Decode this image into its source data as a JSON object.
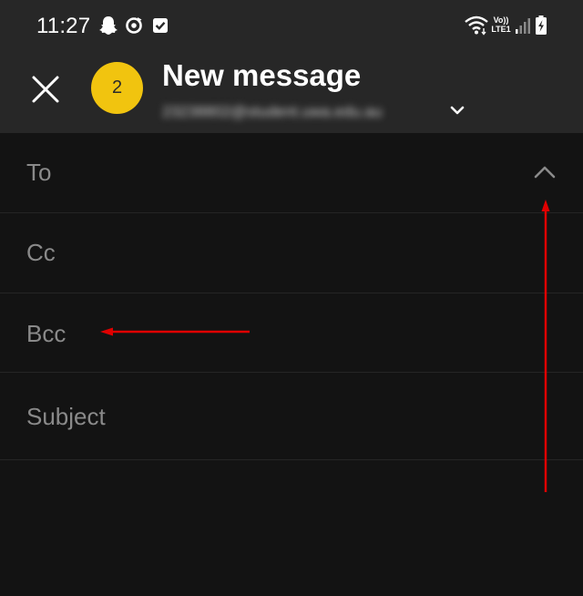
{
  "status_bar": {
    "time": "11:27",
    "icons": [
      "snapchat-icon",
      "sync-icon",
      "checkbox-icon",
      "wifi-icon",
      "signal-icon",
      "battery-charging-icon"
    ],
    "network_top": "Vo))",
    "network_bottom": "LTE1"
  },
  "app_bar": {
    "close_icon": "close-icon",
    "avatar_text": "2",
    "avatar_color": "#f1c40f",
    "title": "New message",
    "sender_email": "23238802@student.uwa.edu.au",
    "sender_chevron_icon": "chevron-down-icon"
  },
  "fields": {
    "to": {
      "label": "To",
      "toggle_icon": "chevron-up-icon"
    },
    "cc": {
      "label": "Cc"
    },
    "bcc": {
      "label": "Bcc"
    },
    "subject": {
      "label": "Subject"
    }
  },
  "annotations": {
    "arrow_color": "#e00000",
    "arrows": [
      "bcc-pointer-arrow",
      "collapse-pointer-arrow"
    ]
  },
  "colors": {
    "background": "#131313",
    "header": "#272727",
    "label": "#8a8a8a",
    "divider": "#252525"
  }
}
